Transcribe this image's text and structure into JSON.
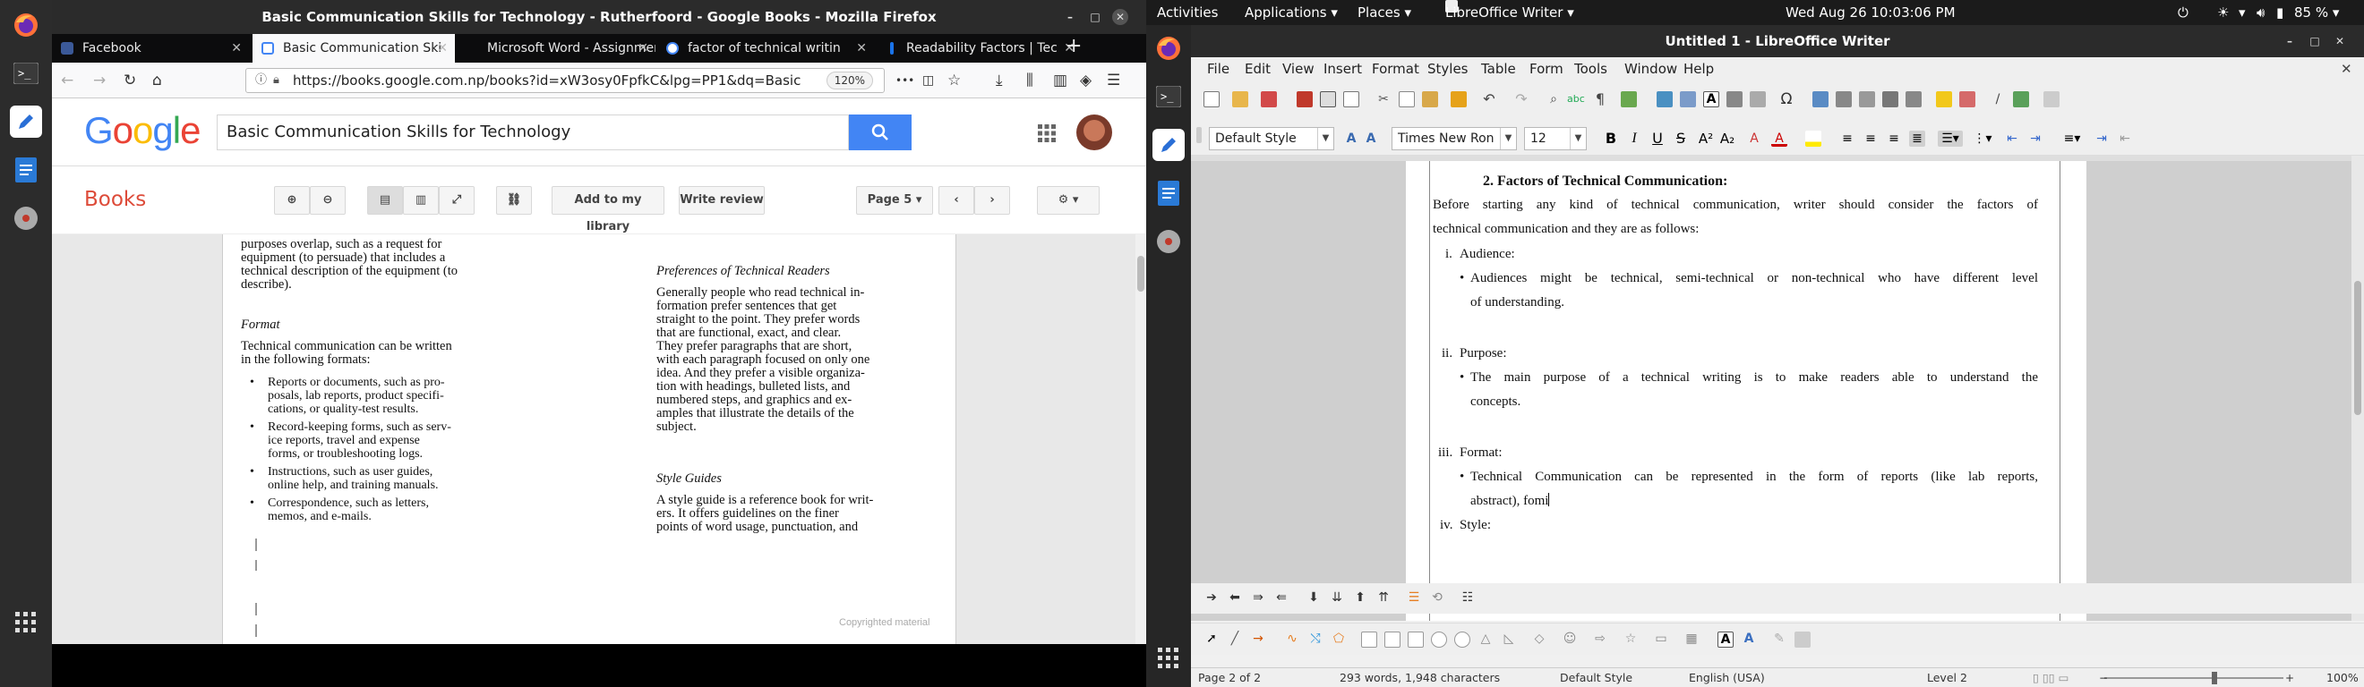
{
  "firefox": {
    "window_title": "Basic Communication Skills for Technology - Rutherfoord - Google Books - Mozilla Firefox",
    "tabs": [
      {
        "label": "Facebook",
        "color": "#3b5998"
      },
      {
        "label": "Basic Communication Ski",
        "color": "#4285f4"
      },
      {
        "label": "Microsoft Word - Assignmen",
        "color": "#888888"
      },
      {
        "label": "factor of technical writin",
        "color": "#4285f4"
      },
      {
        "label": "Readability Factors | Tec",
        "color": "#1a73e8"
      }
    ],
    "url": "https://books.google.com.np/books?id=xW3osy0FpfkC&lpg=PP1&dq=Basic",
    "zoom": "120%",
    "menu_dots": "•••"
  },
  "google_books": {
    "logo_letters": [
      "G",
      "o",
      "o",
      "g",
      "l",
      "e"
    ],
    "logo_colors": [
      "#4285f4",
      "#ea4335",
      "#fbbc05",
      "#4285f4",
      "#34a853",
      "#ea4335"
    ],
    "search_value": "Basic Communication Skills for Technology",
    "section": "Books",
    "add_library": "Add to my library",
    "write_review": "Write review",
    "page_select": "Page 5",
    "left_col": [
      "purposes overlap, such as a request for",
      "equipment (to persuade) that includes a",
      "technical description of the equipment (to",
      "describe)."
    ],
    "format_heading": "Format",
    "format_intro": [
      "Technical communication can be written",
      "in the following formats:"
    ],
    "format_bullets": [
      [
        "Reports or documents, such as pro-",
        "posals, lab reports, product specifi-",
        "cations, or quality-test results."
      ],
      [
        "Record-keeping forms, such as serv-",
        "ice reports, travel and expense",
        "forms, or troubleshooting logs."
      ],
      [
        "Instructions, such as user guides,",
        "online help, and training manuals."
      ],
      [
        "Correspondence, such as letters,",
        "memos, and e-mails."
      ]
    ],
    "pref_heading": "Preferences of Technical Readers",
    "pref_lines": [
      "Generally people who read technical in-",
      "formation prefer sentences that get",
      "straight to the point. They prefer words",
      "that are functional, exact, and clear.",
      "They prefer paragraphs that are short,",
      "with each paragraph focused on only one",
      "idea. And they prefer a visible organiza-",
      "tion with headings, bulleted lists, and",
      "numbered steps, and graphics and ex-",
      "amples that illustrate the details of the",
      "subject."
    ],
    "style_heading": "Style Guides",
    "style_lines": [
      "A style guide is a reference book for writ-",
      "ers. It offers guidelines on the finer",
      "points of word usage, punctuation, and"
    ],
    "watermark": "Copyrighted material"
  },
  "gnome": {
    "activities": "Activities",
    "applications": "Applications ▾",
    "places": "Places ▾",
    "app_menu": "LibreOffice Writer ▾",
    "clock": "Wed Aug 26  10:03:06 PM",
    "battery": "85 % ▾"
  },
  "writer": {
    "window_title": "Untitled 1 - LibreOffice Writer",
    "menu": [
      "File",
      "Edit",
      "View",
      "Insert",
      "Format",
      "Styles",
      "Table",
      "Form",
      "Tools",
      "Window",
      "Help"
    ],
    "para_style": "Default Style",
    "font_name": "Times New Ron",
    "font_size": "12",
    "doc": {
      "heading": "2. Factors of Technical Communication:",
      "intro_1": "Before starting any kind of technical communication, writer should consider the factors of",
      "intro_2": "technical communication and they are as follows:",
      "items": [
        {
          "num": "i.",
          "label": "Audience:",
          "lines": [
            "Audiences might be technical, semi-technical or non-technical who have different level",
            "of understanding."
          ]
        },
        {
          "num": "ii.",
          "label": "Purpose:",
          "lines": [
            "The main purpose of a technical writing is to make readers able to understand the",
            "concepts."
          ]
        },
        {
          "num": "iii.",
          "label": "Format:",
          "lines": [
            "Technical Communication can be represented in the form of reports (like lab reports,",
            "abstract), fomi"
          ]
        },
        {
          "num": "iv.",
          "label": "Style:",
          "lines": []
        }
      ],
      "bullet": "•"
    },
    "status": {
      "page": "Page 2 of 2",
      "words": "293 words, 1,948 characters",
      "style": "Default Style",
      "lang": "English (USA)",
      "level": "Level 2",
      "zoom": "100%"
    }
  }
}
